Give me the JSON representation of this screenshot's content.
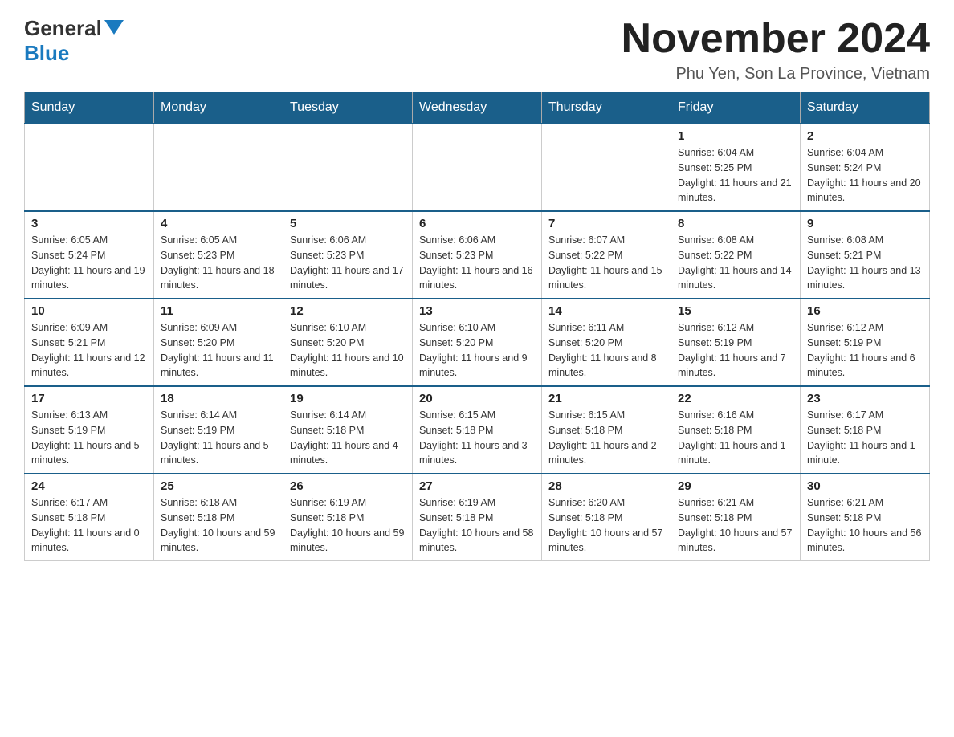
{
  "header": {
    "logo_general": "General",
    "logo_blue": "Blue",
    "month_title": "November 2024",
    "location": "Phu Yen, Son La Province, Vietnam"
  },
  "weekdays": [
    "Sunday",
    "Monday",
    "Tuesday",
    "Wednesday",
    "Thursday",
    "Friday",
    "Saturday"
  ],
  "weeks": [
    [
      {
        "day": "",
        "info": ""
      },
      {
        "day": "",
        "info": ""
      },
      {
        "day": "",
        "info": ""
      },
      {
        "day": "",
        "info": ""
      },
      {
        "day": "",
        "info": ""
      },
      {
        "day": "1",
        "info": "Sunrise: 6:04 AM\nSunset: 5:25 PM\nDaylight: 11 hours and 21 minutes."
      },
      {
        "day": "2",
        "info": "Sunrise: 6:04 AM\nSunset: 5:24 PM\nDaylight: 11 hours and 20 minutes."
      }
    ],
    [
      {
        "day": "3",
        "info": "Sunrise: 6:05 AM\nSunset: 5:24 PM\nDaylight: 11 hours and 19 minutes."
      },
      {
        "day": "4",
        "info": "Sunrise: 6:05 AM\nSunset: 5:23 PM\nDaylight: 11 hours and 18 minutes."
      },
      {
        "day": "5",
        "info": "Sunrise: 6:06 AM\nSunset: 5:23 PM\nDaylight: 11 hours and 17 minutes."
      },
      {
        "day": "6",
        "info": "Sunrise: 6:06 AM\nSunset: 5:23 PM\nDaylight: 11 hours and 16 minutes."
      },
      {
        "day": "7",
        "info": "Sunrise: 6:07 AM\nSunset: 5:22 PM\nDaylight: 11 hours and 15 minutes."
      },
      {
        "day": "8",
        "info": "Sunrise: 6:08 AM\nSunset: 5:22 PM\nDaylight: 11 hours and 14 minutes."
      },
      {
        "day": "9",
        "info": "Sunrise: 6:08 AM\nSunset: 5:21 PM\nDaylight: 11 hours and 13 minutes."
      }
    ],
    [
      {
        "day": "10",
        "info": "Sunrise: 6:09 AM\nSunset: 5:21 PM\nDaylight: 11 hours and 12 minutes."
      },
      {
        "day": "11",
        "info": "Sunrise: 6:09 AM\nSunset: 5:20 PM\nDaylight: 11 hours and 11 minutes."
      },
      {
        "day": "12",
        "info": "Sunrise: 6:10 AM\nSunset: 5:20 PM\nDaylight: 11 hours and 10 minutes."
      },
      {
        "day": "13",
        "info": "Sunrise: 6:10 AM\nSunset: 5:20 PM\nDaylight: 11 hours and 9 minutes."
      },
      {
        "day": "14",
        "info": "Sunrise: 6:11 AM\nSunset: 5:20 PM\nDaylight: 11 hours and 8 minutes."
      },
      {
        "day": "15",
        "info": "Sunrise: 6:12 AM\nSunset: 5:19 PM\nDaylight: 11 hours and 7 minutes."
      },
      {
        "day": "16",
        "info": "Sunrise: 6:12 AM\nSunset: 5:19 PM\nDaylight: 11 hours and 6 minutes."
      }
    ],
    [
      {
        "day": "17",
        "info": "Sunrise: 6:13 AM\nSunset: 5:19 PM\nDaylight: 11 hours and 5 minutes."
      },
      {
        "day": "18",
        "info": "Sunrise: 6:14 AM\nSunset: 5:19 PM\nDaylight: 11 hours and 5 minutes."
      },
      {
        "day": "19",
        "info": "Sunrise: 6:14 AM\nSunset: 5:18 PM\nDaylight: 11 hours and 4 minutes."
      },
      {
        "day": "20",
        "info": "Sunrise: 6:15 AM\nSunset: 5:18 PM\nDaylight: 11 hours and 3 minutes."
      },
      {
        "day": "21",
        "info": "Sunrise: 6:15 AM\nSunset: 5:18 PM\nDaylight: 11 hours and 2 minutes."
      },
      {
        "day": "22",
        "info": "Sunrise: 6:16 AM\nSunset: 5:18 PM\nDaylight: 11 hours and 1 minute."
      },
      {
        "day": "23",
        "info": "Sunrise: 6:17 AM\nSunset: 5:18 PM\nDaylight: 11 hours and 1 minute."
      }
    ],
    [
      {
        "day": "24",
        "info": "Sunrise: 6:17 AM\nSunset: 5:18 PM\nDaylight: 11 hours and 0 minutes."
      },
      {
        "day": "25",
        "info": "Sunrise: 6:18 AM\nSunset: 5:18 PM\nDaylight: 10 hours and 59 minutes."
      },
      {
        "day": "26",
        "info": "Sunrise: 6:19 AM\nSunset: 5:18 PM\nDaylight: 10 hours and 59 minutes."
      },
      {
        "day": "27",
        "info": "Sunrise: 6:19 AM\nSunset: 5:18 PM\nDaylight: 10 hours and 58 minutes."
      },
      {
        "day": "28",
        "info": "Sunrise: 6:20 AM\nSunset: 5:18 PM\nDaylight: 10 hours and 57 minutes."
      },
      {
        "day": "29",
        "info": "Sunrise: 6:21 AM\nSunset: 5:18 PM\nDaylight: 10 hours and 57 minutes."
      },
      {
        "day": "30",
        "info": "Sunrise: 6:21 AM\nSunset: 5:18 PM\nDaylight: 10 hours and 56 minutes."
      }
    ]
  ]
}
